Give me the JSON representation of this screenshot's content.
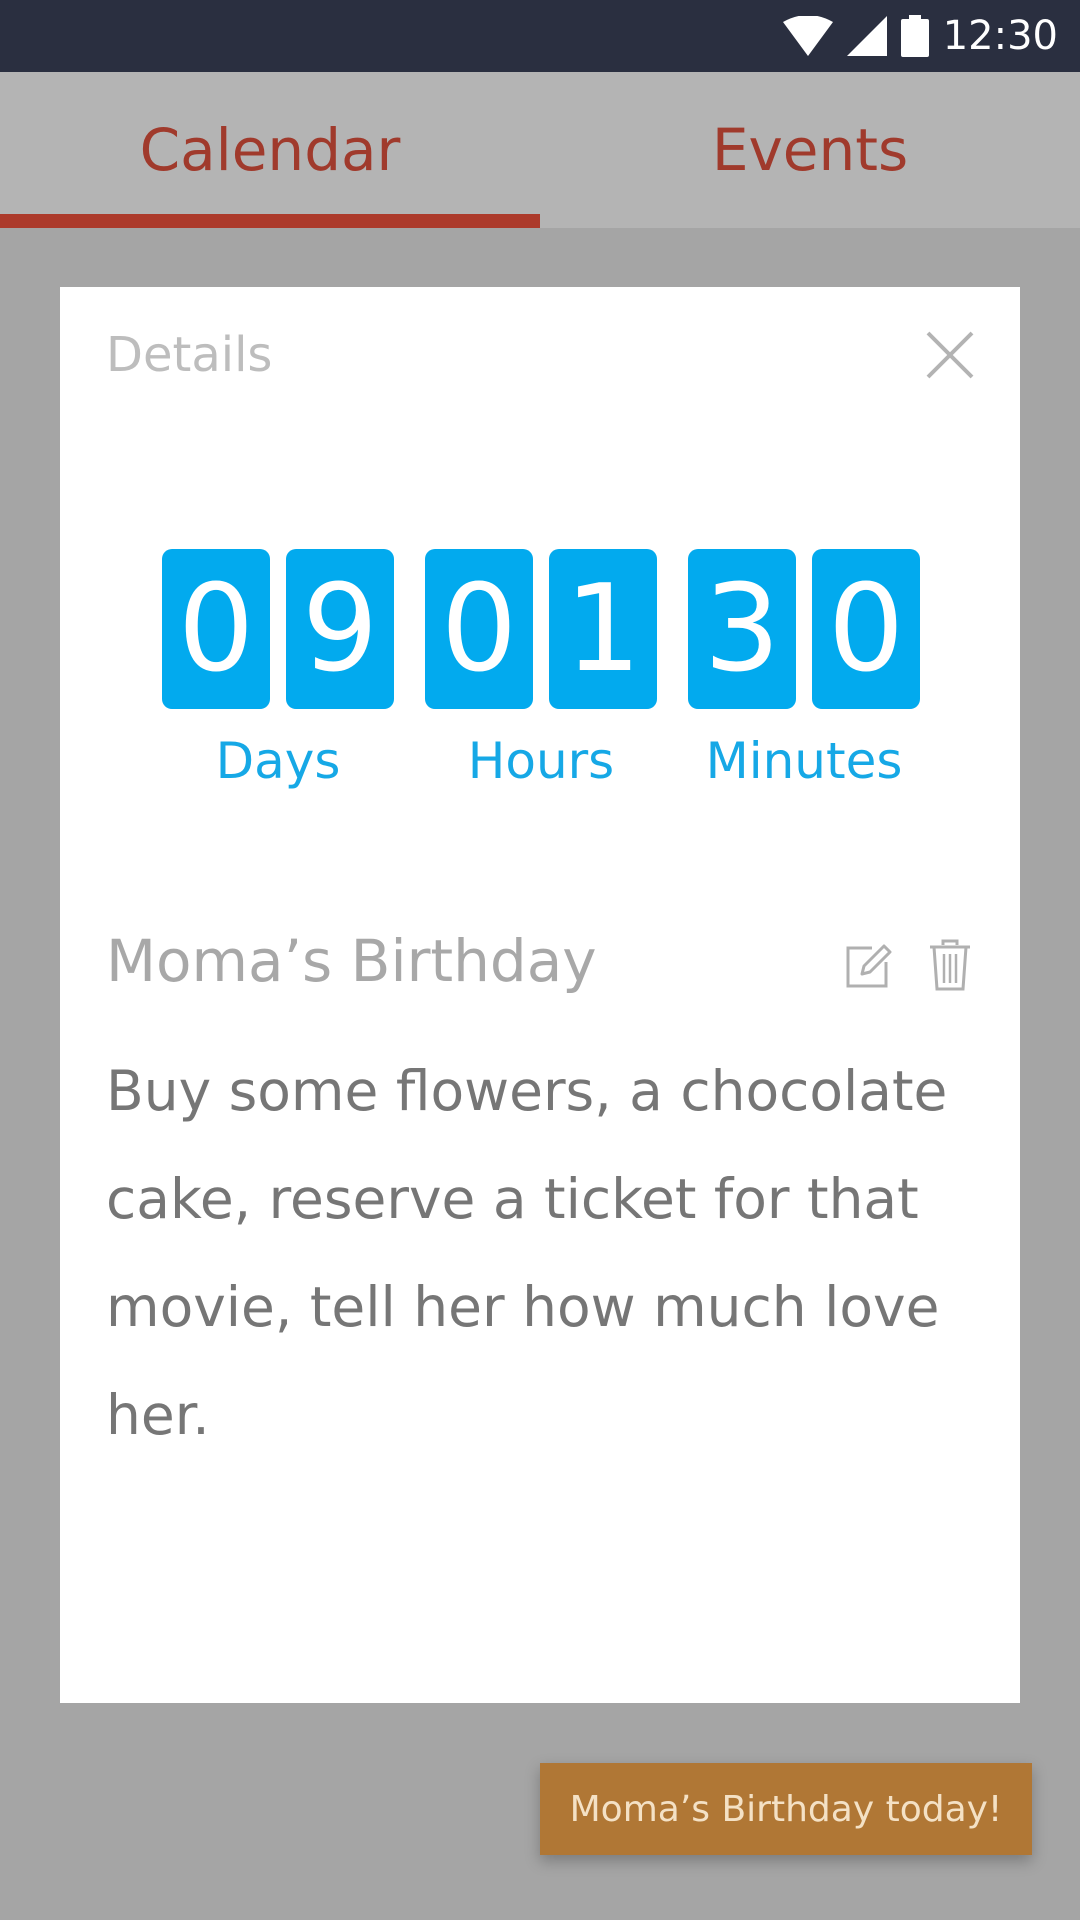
{
  "status_bar": {
    "time": "12:30",
    "icons": [
      "wifi-icon",
      "signal-icon",
      "battery-icon"
    ]
  },
  "tabs": [
    {
      "label": "Calendar",
      "selected": true
    },
    {
      "label": "Events",
      "selected": false
    }
  ],
  "dialog": {
    "title": "Details",
    "close_icon": "close-icon",
    "countdown": {
      "digits": [
        "0",
        "9",
        "0",
        "1",
        "3",
        "0"
      ],
      "units": [
        "Days",
        "Hours",
        "Minutes"
      ]
    },
    "event": {
      "title": "Moma’s Birthday",
      "description": "Buy some flowers, a chocolate cake, reserve a ticket for that movie, tell her how much love her.",
      "actions": [
        "edit-icon",
        "trash-icon"
      ]
    }
  },
  "toast": {
    "text": "Moma’s Birthday today!"
  },
  "colors": {
    "status_bar": "#2a2f40",
    "tab_bar": "#b4b4b4",
    "tab_text": "#a03a2c",
    "tab_indicator": "#ac3a2b",
    "overlay": "#a5a5a5",
    "digit_bg": "#02aaee",
    "unit_label": "#16a8e6",
    "toast_bg": "#b07735"
  }
}
